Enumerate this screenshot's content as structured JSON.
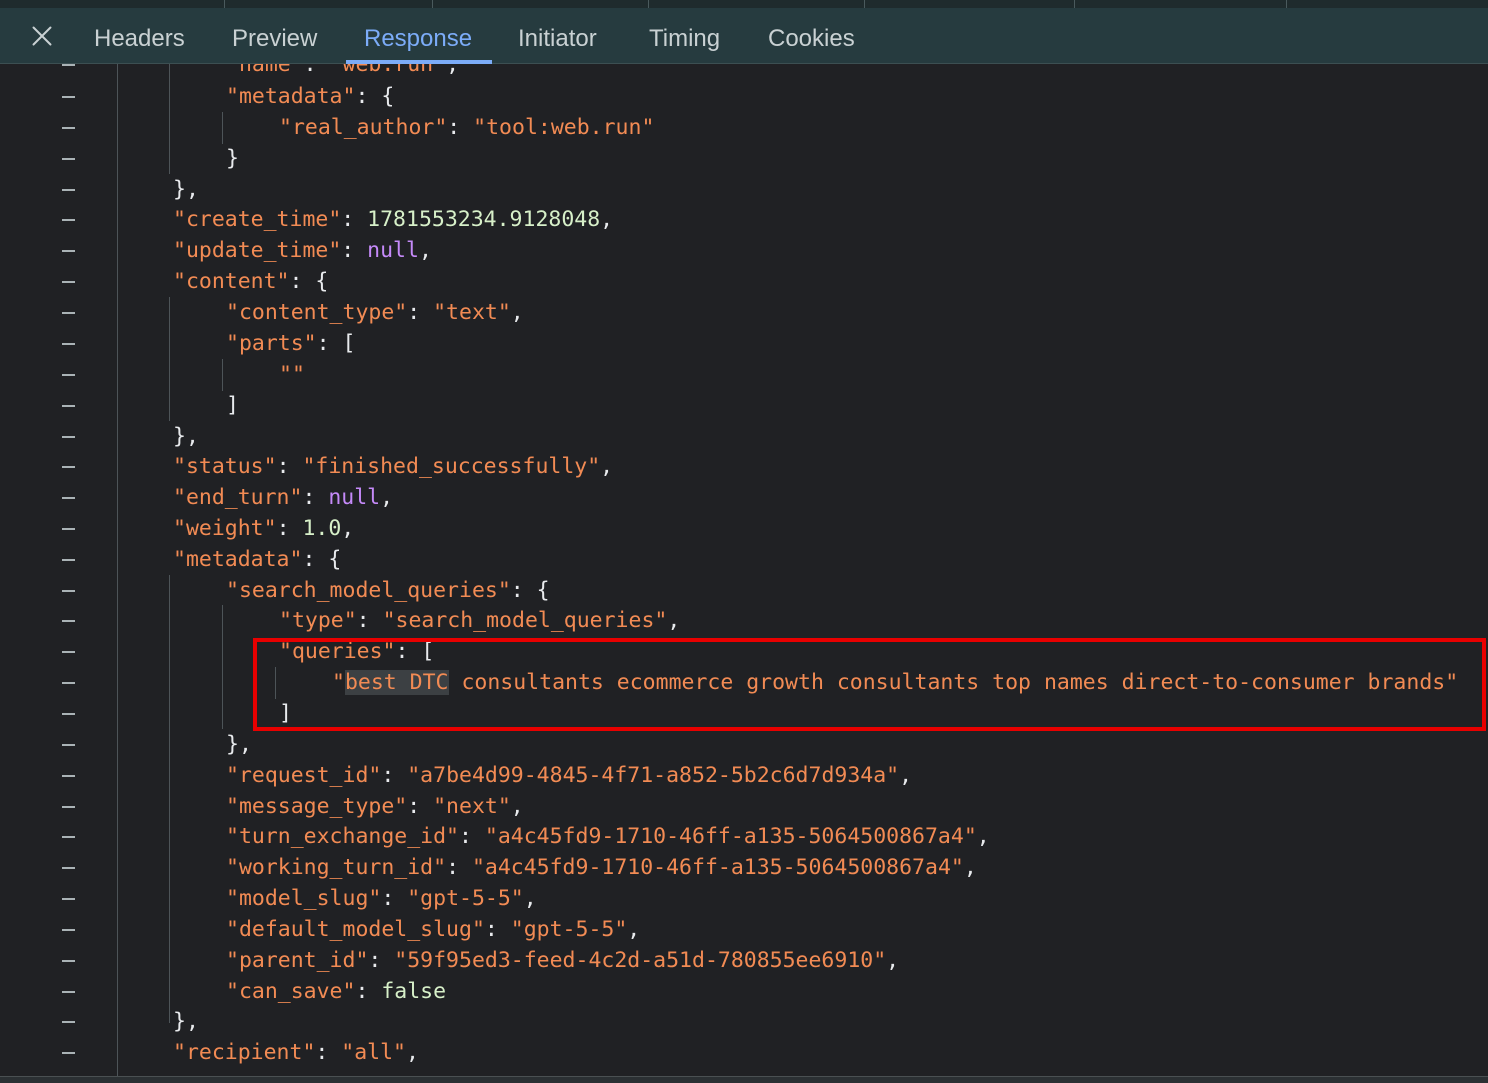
{
  "tabs": {
    "headers": "Headers",
    "preview": "Preview",
    "response": "Response",
    "initiator": "Initiator",
    "timing": "Timing",
    "cookies": "Cookies"
  },
  "code": {
    "l0": {
      "key": "\"name\"",
      "val": "\"web.run\"",
      "tail": ","
    },
    "l1": {
      "key": "\"metadata\"",
      "tail": ": {"
    },
    "l2": {
      "key": "\"real_author\"",
      "val": "\"tool:web.run\""
    },
    "l3": {
      "text": "}"
    },
    "l4": {
      "text": "},"
    },
    "l5": {
      "key": "\"create_time\"",
      "val": "1781553234.9128048",
      "tail": ","
    },
    "l6": {
      "key": "\"update_time\"",
      "val": "null",
      "tail": ","
    },
    "l7": {
      "key": "\"content\"",
      "tail": ": {"
    },
    "l8": {
      "key": "\"content_type\"",
      "val": "\"text\"",
      "tail": ","
    },
    "l9": {
      "key": "\"parts\"",
      "tail": ": ["
    },
    "l10": {
      "val": "\"\""
    },
    "l11": {
      "text": "]"
    },
    "l12": {
      "text": "},"
    },
    "l13": {
      "key": "\"status\"",
      "val": "\"finished_successfully\"",
      "tail": ","
    },
    "l14": {
      "key": "\"end_turn\"",
      "val": "null",
      "tail": ","
    },
    "l15": {
      "key": "\"weight\"",
      "val": "1.0",
      "tail": ","
    },
    "l16": {
      "key": "\"metadata\"",
      "tail": ": {"
    },
    "l17": {
      "key": "\"search_model_queries\"",
      "tail": ": {"
    },
    "l18": {
      "key": "\"type\"",
      "val": "\"search_model_queries\"",
      "tail": ","
    },
    "l19": {
      "key": "\"queries\"",
      "tail": ": ["
    },
    "l20": {
      "q_open": "\"",
      "q_hl": "best DTC",
      "q_rest": " consultants ecommerce growth consultants top names direct-to-consumer brands\""
    },
    "l21": {
      "text": "]"
    },
    "l22": {
      "text": "},"
    },
    "l23": {
      "key": "\"request_id\"",
      "val": "\"a7be4d99-4845-4f71-a852-5b2c6d7d934a\"",
      "tail": ","
    },
    "l24": {
      "key": "\"message_type\"",
      "val": "\"next\"",
      "tail": ","
    },
    "l25": {
      "key": "\"turn_exchange_id\"",
      "val": "\"a4c45fd9-1710-46ff-a135-5064500867a4\"",
      "tail": ","
    },
    "l26": {
      "key": "\"working_turn_id\"",
      "val": "\"a4c45fd9-1710-46ff-a135-5064500867a4\"",
      "tail": ","
    },
    "l27": {
      "key": "\"model_slug\"",
      "val": "\"gpt-5-5\"",
      "tail": ","
    },
    "l28": {
      "key": "\"default_model_slug\"",
      "val": "\"gpt-5-5\"",
      "tail": ","
    },
    "l29": {
      "key": "\"parent_id\"",
      "val": "\"59f95ed3-feed-4c2d-a51d-780855ee6910\"",
      "tail": ","
    },
    "l30": {
      "key": "\"can_save\"",
      "val": "false"
    },
    "l31": {
      "text": "},"
    },
    "l32": {
      "key": "\"recipient\"",
      "val": "\"all\"",
      "tail": ","
    }
  }
}
